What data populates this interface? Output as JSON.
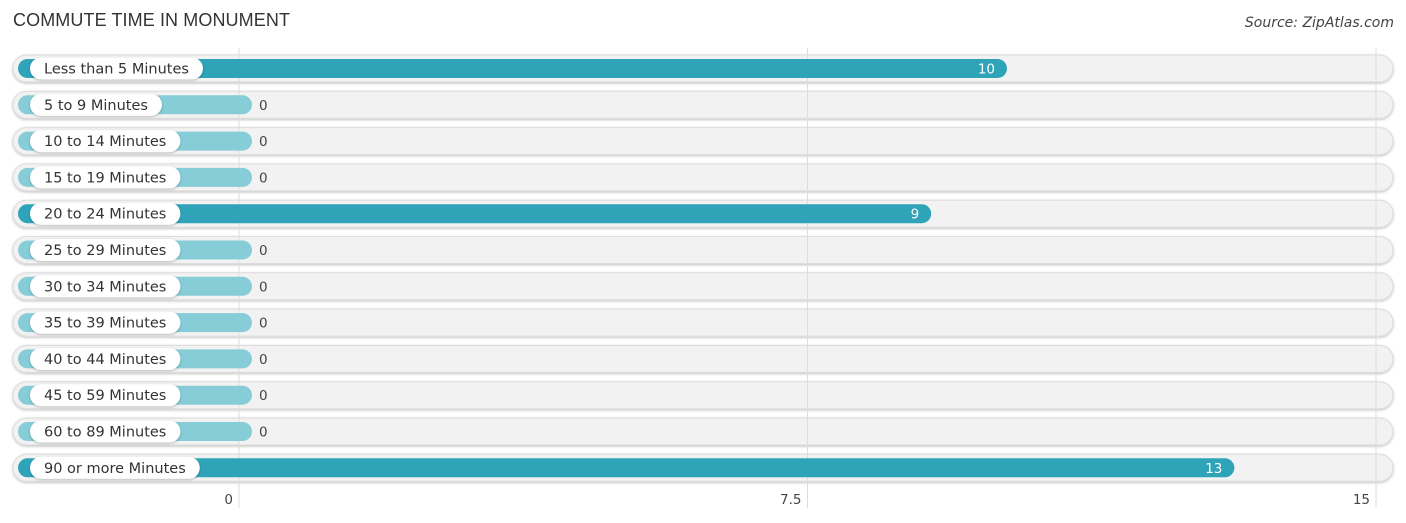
{
  "header": {
    "title": "COMMUTE TIME IN MONUMENT",
    "source": "Source: ZipAtlas.com"
  },
  "colors": {
    "bar_strong": "#2fa4b8",
    "bar_zero": "#86cdd8",
    "track": "#f2f2f2",
    "grid": "#dddddd"
  },
  "chart_data": {
    "type": "bar",
    "orientation": "horizontal",
    "title": "COMMUTE TIME IN MONUMENT",
    "xlabel": "",
    "ylabel": "",
    "categories": [
      "Less than 5 Minutes",
      "5 to 9 Minutes",
      "10 to 14 Minutes",
      "15 to 19 Minutes",
      "20 to 24 Minutes",
      "25 to 29 Minutes",
      "30 to 34 Minutes",
      "35 to 39 Minutes",
      "40 to 44 Minutes",
      "45 to 59 Minutes",
      "60 to 89 Minutes",
      "90 or more Minutes"
    ],
    "values": [
      10,
      0,
      0,
      0,
      9,
      0,
      0,
      0,
      0,
      0,
      0,
      13
    ],
    "value_labels": [
      "10",
      "0",
      "0",
      "0",
      "9",
      "0",
      "0",
      "0",
      "0",
      "0",
      "0",
      "13"
    ],
    "xlim": [
      0,
      15
    ],
    "ticks": [
      0,
      7.5,
      15
    ],
    "tick_labels": [
      "0",
      "7.5",
      "15"
    ],
    "grid": true,
    "legend": "none"
  }
}
